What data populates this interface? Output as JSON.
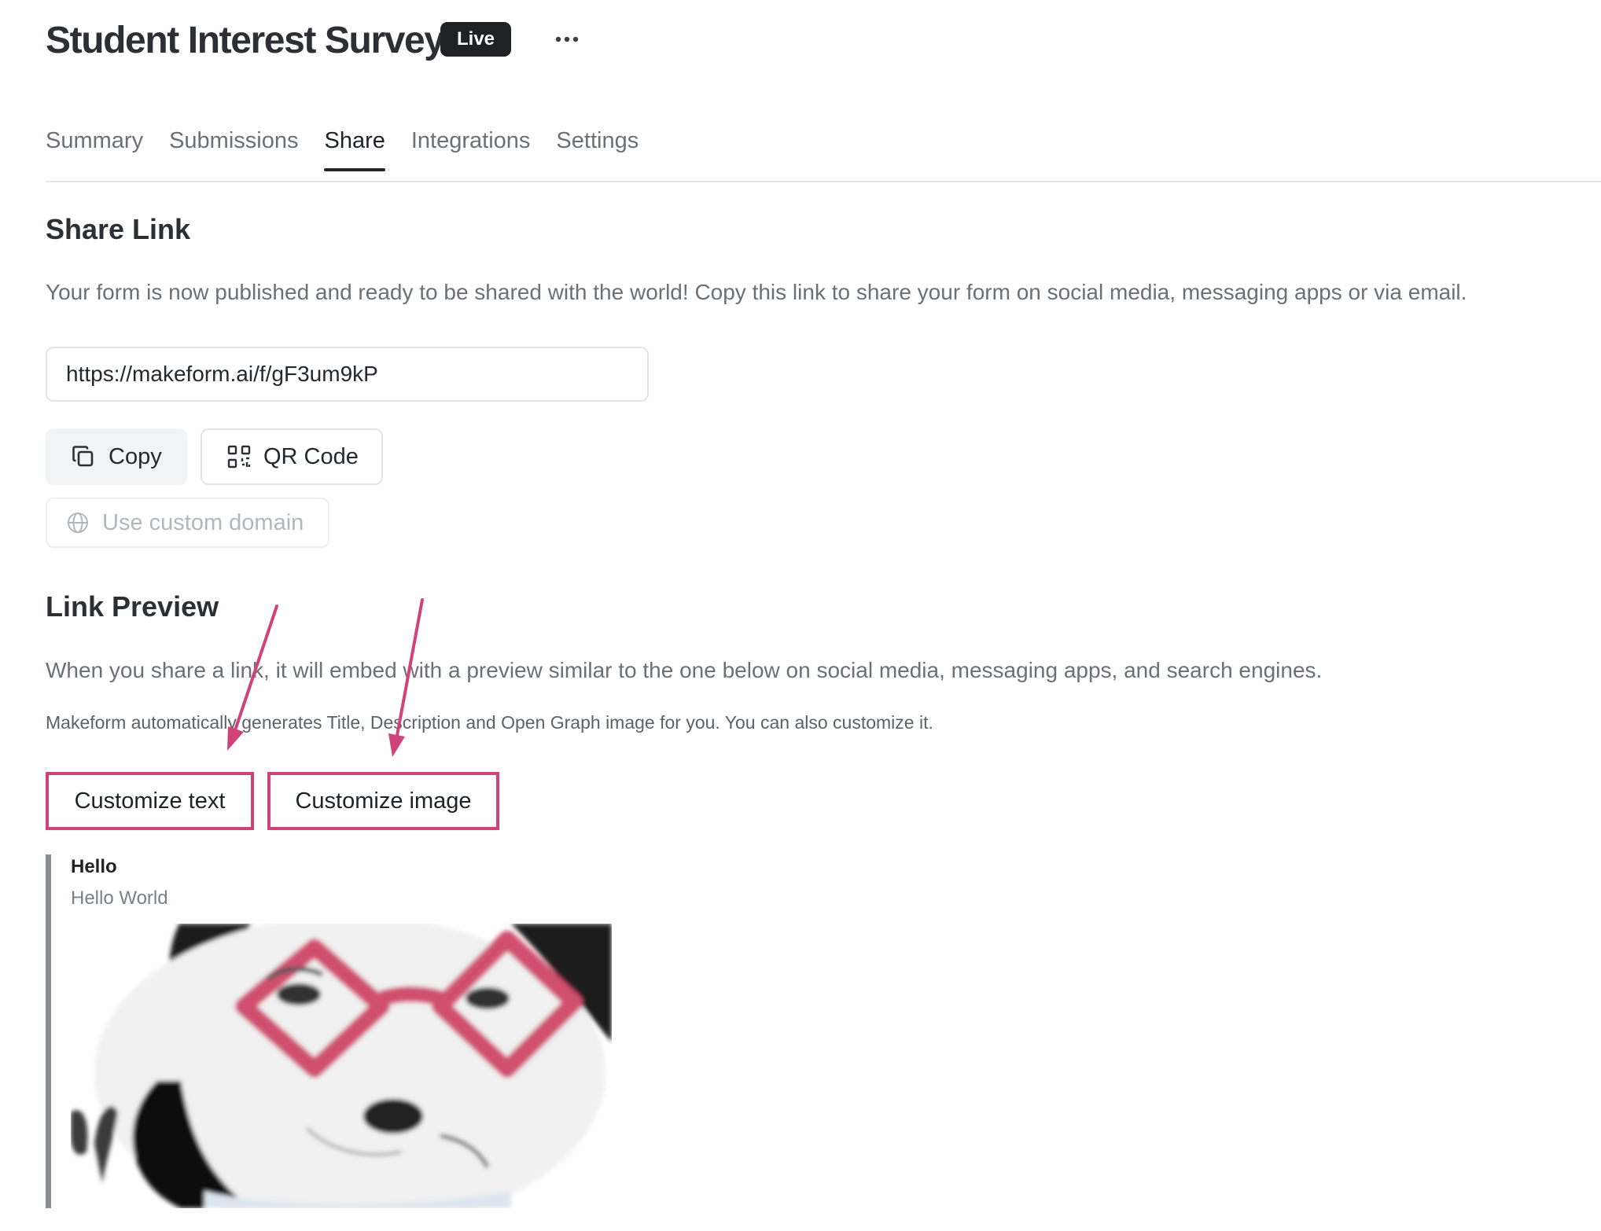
{
  "header": {
    "title": "Student Interest Survey",
    "status_badge": "Live",
    "more_icon": "ellipsis-icon"
  },
  "tabs": [
    {
      "label": "Summary",
      "active": false
    },
    {
      "label": "Submissions",
      "active": false
    },
    {
      "label": "Share",
      "active": true
    },
    {
      "label": "Integrations",
      "active": false
    },
    {
      "label": "Settings",
      "active": false
    }
  ],
  "share_link": {
    "heading": "Share Link",
    "description": "Your form is now published and ready to be shared with the world! Copy this link to share your form on social media, messaging apps or via email.",
    "url": "https://makeform.ai/f/gF3um9kP",
    "copy_label": "Copy",
    "copy_icon": "copy-icon",
    "qr_label": "QR Code",
    "qr_icon": "qr-code-icon",
    "custom_domain_label": "Use custom domain",
    "custom_domain_icon": "globe-icon"
  },
  "link_preview": {
    "heading": "Link Preview",
    "description": "When you share a link, it will embed with a preview similar to the one below on social media, messaging apps, and search engines.",
    "note": "Makeform automatically generates Title, Description and Open Graph image for you. You can also customize it.",
    "customize_text_label": "Customize text",
    "customize_image_label": "Customize image",
    "preview_title": "Hello",
    "preview_description": "Hello World"
  },
  "colors": {
    "annotation": "#d0437a",
    "badge_bg": "#1f2124",
    "preview_bar": "#8b8d92"
  }
}
